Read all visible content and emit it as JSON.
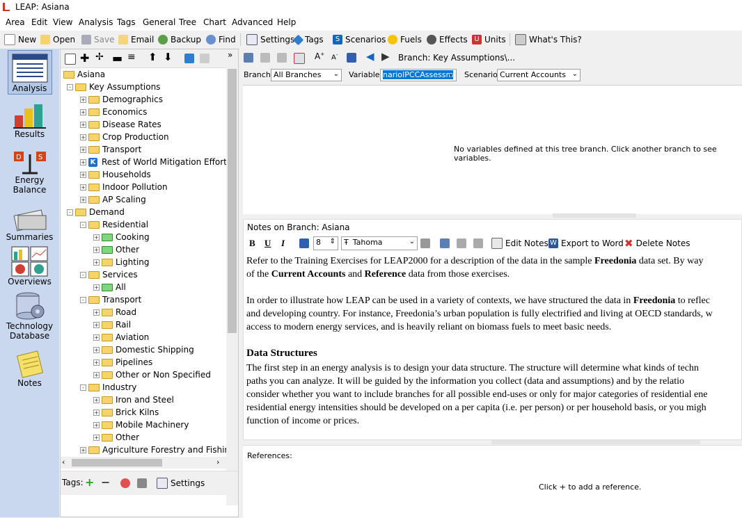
{
  "window": {
    "title": "LEAP: Asiana"
  },
  "menu": [
    "Area",
    "Edit",
    "View",
    "Analysis",
    "Tags",
    "General",
    "Tree",
    "Chart",
    "Advanced",
    "Help"
  ],
  "toolbar": {
    "new": "New",
    "open": "Open",
    "save": "Save",
    "email": "Email",
    "backup": "Backup",
    "find": "Find",
    "settings": "Settings",
    "tags": "Tags",
    "scenarios": "Scenarios",
    "fuels": "Fuels",
    "effects": "Effects",
    "units": "Units",
    "whats_this": "What's This?"
  },
  "sidebar": {
    "analysis": "Analysis",
    "results": "Results",
    "energy_balance_1": "Energy",
    "energy_balance_2": "Balance",
    "summaries": "Summaries",
    "overviews": "Overviews",
    "techdb_1": "Technology",
    "techdb_2": "Database",
    "notes": "Notes"
  },
  "tree": [
    {
      "label": "Asiana",
      "level": 0,
      "type": "folder"
    },
    {
      "label": "Key Assumptions",
      "level": 1,
      "type": "folder",
      "exp": "-"
    },
    {
      "label": "Demographics",
      "level": 2,
      "type": "folder",
      "exp": "+"
    },
    {
      "label": "Economics",
      "level": 2,
      "type": "folder",
      "exp": "+"
    },
    {
      "label": "Disease Rates",
      "level": 2,
      "type": "folder",
      "exp": "+"
    },
    {
      "label": "Crop Production",
      "level": 2,
      "type": "folder",
      "exp": "+"
    },
    {
      "label": "Transport",
      "level": 2,
      "type": "folder",
      "exp": "+"
    },
    {
      "label": "Rest of World Mitigation Effort",
      "level": 2,
      "type": "k",
      "exp": "+"
    },
    {
      "label": "Households",
      "level": 2,
      "type": "folder",
      "exp": "+"
    },
    {
      "label": "Indoor Pollution",
      "level": 2,
      "type": "folder",
      "exp": "+"
    },
    {
      "label": "AP Scaling",
      "level": 2,
      "type": "folder",
      "exp": "+"
    },
    {
      "label": "Demand",
      "level": 1,
      "type": "folder",
      "exp": "-"
    },
    {
      "label": "Residential",
      "level": 2,
      "type": "folder",
      "exp": "-"
    },
    {
      "label": "Cooking",
      "level": 3,
      "type": "green",
      "exp": "+"
    },
    {
      "label": "Other",
      "level": 3,
      "type": "green",
      "exp": "+"
    },
    {
      "label": "Lighting",
      "level": 3,
      "type": "folder",
      "exp": "+"
    },
    {
      "label": "Services",
      "level": 2,
      "type": "folder",
      "exp": "-"
    },
    {
      "label": "All",
      "level": 3,
      "type": "green",
      "exp": "+"
    },
    {
      "label": "Transport",
      "level": 2,
      "type": "folder",
      "exp": "-"
    },
    {
      "label": "Road",
      "level": 3,
      "type": "folder",
      "exp": "+"
    },
    {
      "label": "Rail",
      "level": 3,
      "type": "folder",
      "exp": "+"
    },
    {
      "label": "Aviation",
      "level": 3,
      "type": "folder",
      "exp": "+"
    },
    {
      "label": "Domestic Shipping",
      "level": 3,
      "type": "folder",
      "exp": "+"
    },
    {
      "label": "Pipelines",
      "level": 3,
      "type": "folder",
      "exp": "+"
    },
    {
      "label": "Other or Non Specified",
      "level": 3,
      "type": "folder",
      "exp": "+"
    },
    {
      "label": "Industry",
      "level": 2,
      "type": "folder",
      "exp": "-"
    },
    {
      "label": "Iron and Steel",
      "level": 3,
      "type": "folder",
      "exp": "+"
    },
    {
      "label": "Brick Kilns",
      "level": 3,
      "type": "folder",
      "exp": "+"
    },
    {
      "label": "Mobile Machinery",
      "level": 3,
      "type": "folder",
      "exp": "+"
    },
    {
      "label": "Other",
      "level": 3,
      "type": "folder",
      "exp": "+"
    },
    {
      "label": "Agriculture Forestry and Fishing",
      "level": 2,
      "type": "folder",
      "exp": "+"
    }
  ],
  "tags_bar": {
    "label": "Tags:",
    "settings": "Settings"
  },
  "breadcrumb": "Branch: Key Assumptions\\...",
  "selectors": {
    "branch_label": "Branch:",
    "branch_value": "All Branches",
    "variable_label": "Variable:",
    "variable_value": "narioIPCCAssessm",
    "scenario_label": "Scenario:",
    "scenario_value": "Current Accounts"
  },
  "variables_message": "No variables defined at this tree branch. Click another branch to see variables.",
  "notes": {
    "header": "Notes on Branch: Asiana",
    "bold": "B",
    "underline": "U",
    "italic": "I",
    "font_size": "8",
    "font_name": "Tahoma",
    "edit_notes": "Edit Notes",
    "export_word": "Export to Word",
    "delete_notes": "Delete Notes",
    "p1_a": "Refer to the Training Exercises for LEAP2000 for a description of the data in the sample ",
    "p1_b": "Freedonia",
    "p1_c": " data set.  By way",
    "p1_d": "of the ",
    "p1_e": "Current Accounts",
    "p1_f": " and ",
    "p1_g": "Reference",
    "p1_h": " data from those exercises.",
    "p2_a": "In order to illustrate how LEAP can be used in a variety of contexts, we have structured the data in ",
    "p2_b": "Freedonia",
    "p2_c": " to reflec",
    "p2_d": "and developing country.  For instance, Freedonia’s urban population is fully electrified and living at OECD standards, w",
    "p2_e": "access to modern energy services, and is heavily reliant on biomass fuels to meet basic needs.",
    "h_data": "Data Structures",
    "p3_1": "The first step in an energy analysis is to design your data structure.  The structure will determine what kinds of techn",
    "p3_2": "paths you can analyze.  It will be guided by the information you collect (data and assumptions) and by the relatio",
    "p3_3": "consider whether you want to include branches for all possible end-uses or only for major categories of residential ene",
    "p3_4": "residential energy intensities should be developed on a per capita (i.e. per person) or per household basis, or you migh",
    "p3_5": "function of income or prices."
  },
  "references": {
    "label": "References:",
    "hint": "Click + to add a reference."
  },
  "colors": {
    "sidebar": "#c9d8ee",
    "selection": "#0078d7",
    "folder": "#f7d46a"
  }
}
